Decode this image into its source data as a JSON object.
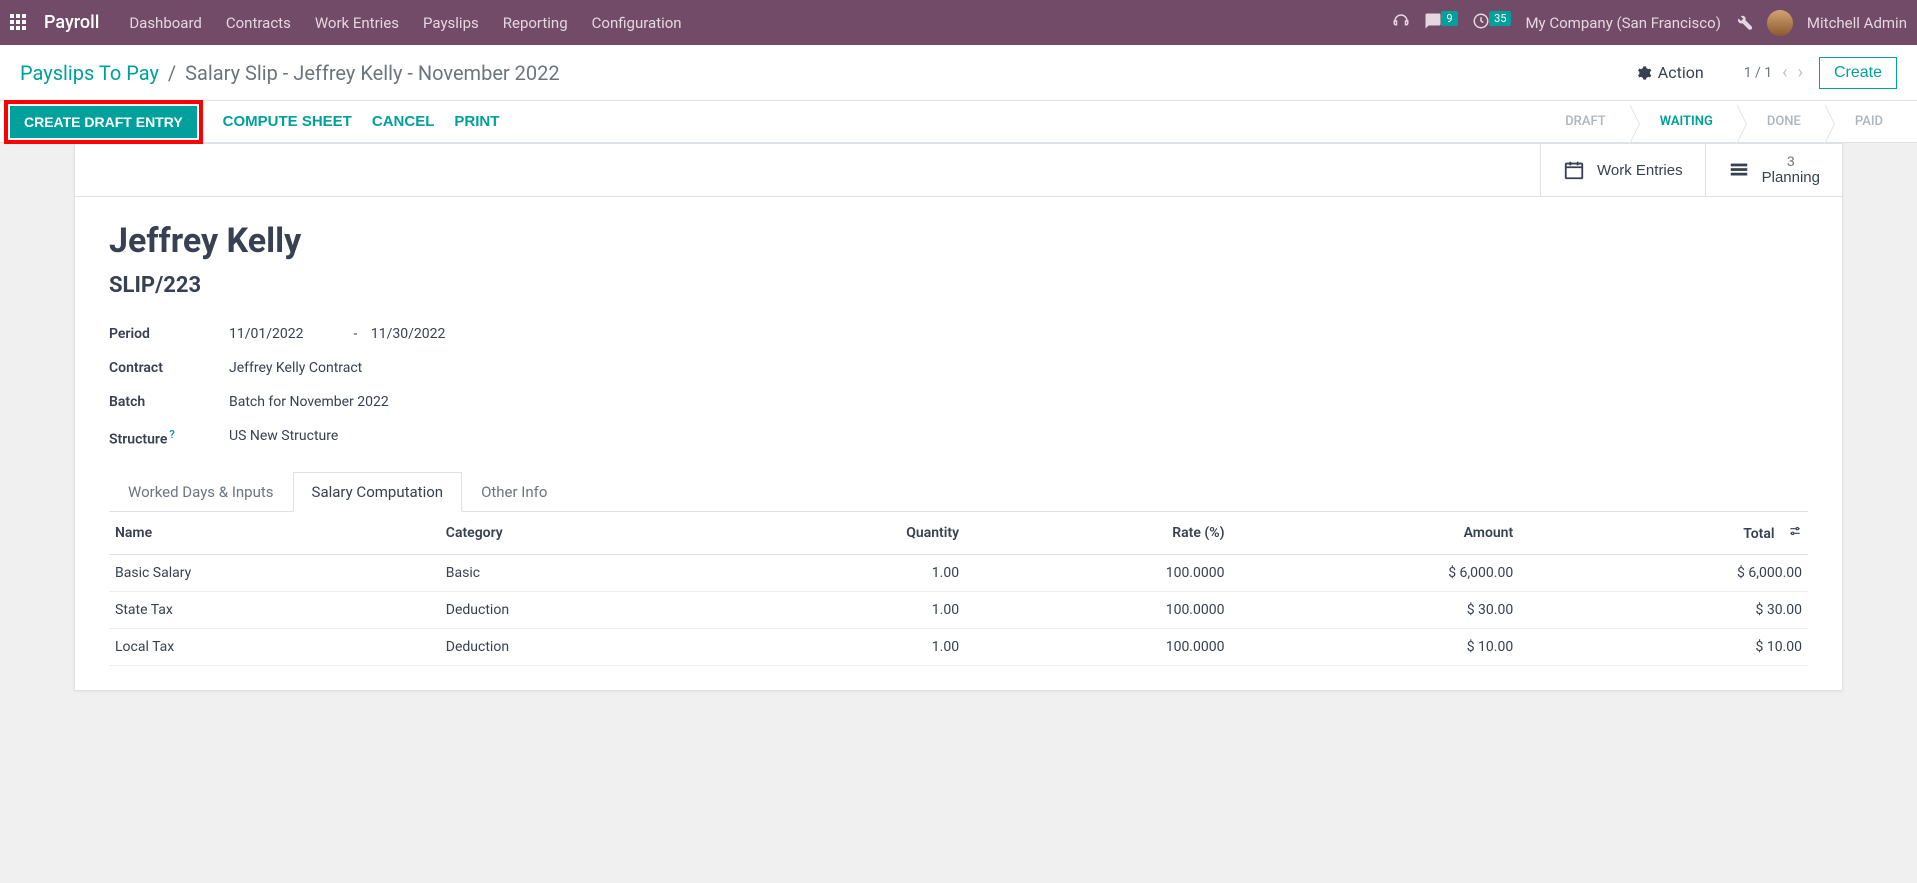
{
  "topbar": {
    "brand": "Payroll",
    "menu": [
      "Dashboard",
      "Contracts",
      "Work Entries",
      "Payslips",
      "Reporting",
      "Configuration"
    ],
    "chat_badge": "9",
    "clock_badge": "35",
    "company": "My Company (San Francisco)",
    "user": "Mitchell Admin"
  },
  "breadcrumb": {
    "parent": "Payslips To Pay",
    "current": "Salary Slip - Jeffrey Kelly - November 2022"
  },
  "toolbar": {
    "action": "Action",
    "pager": "1 / 1",
    "create": "Create"
  },
  "statusbar": {
    "buttons": {
      "create_draft": "CREATE DRAFT ENTRY",
      "compute": "COMPUTE SHEET",
      "cancel": "CANCEL",
      "print": "PRINT"
    },
    "steps": [
      "DRAFT",
      "WAITING",
      "DONE",
      "PAID"
    ],
    "active_step": "WAITING"
  },
  "stat_buttons": {
    "work_entries": "Work Entries",
    "planning_count": "3",
    "planning": "Planning"
  },
  "record": {
    "title": "Jeffrey Kelly",
    "subtitle": "SLIP/223",
    "labels": {
      "period": "Period",
      "contract": "Contract",
      "batch": "Batch",
      "structure": "Structure"
    },
    "period_from": "11/01/2022",
    "period_to": "11/30/2022",
    "contract": "Jeffrey Kelly Contract",
    "batch": "Batch for November 2022",
    "structure": "US New Structure"
  },
  "tabs": [
    "Worked Days & Inputs",
    "Salary Computation",
    "Other Info"
  ],
  "active_tab": "Salary Computation",
  "table": {
    "headers": [
      "Name",
      "Category",
      "Quantity",
      "Rate (%)",
      "Amount",
      "Total"
    ],
    "rows": [
      {
        "name": "Basic Salary",
        "category": "Basic",
        "qty": "1.00",
        "rate": "100.0000",
        "amount": "$ 6,000.00",
        "total": "$ 6,000.00"
      },
      {
        "name": "State Tax",
        "category": "Deduction",
        "qty": "1.00",
        "rate": "100.0000",
        "amount": "$ 30.00",
        "total": "$ 30.00"
      },
      {
        "name": "Local Tax",
        "category": "Deduction",
        "qty": "1.00",
        "rate": "100.0000",
        "amount": "$ 10.00",
        "total": "$ 10.00"
      }
    ]
  }
}
